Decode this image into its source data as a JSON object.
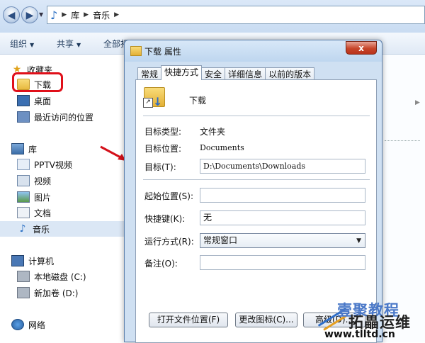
{
  "explorer": {
    "address": [
      "库",
      "音乐"
    ],
    "toolbar": {
      "organize": "组织",
      "share": "共享",
      "play_all": "全部播"
    },
    "sidebar": {
      "favorites": "收藏夹",
      "downloads": "下载",
      "desktop": "桌面",
      "recent": "最近访问的位置",
      "libraries": "库",
      "pptv": "PPTV视频",
      "videos": "视频",
      "pictures": "图片",
      "documents": "文档",
      "music": "音乐",
      "computer": "计算机",
      "local_disk": "本地磁盘 (C:)",
      "new_volume": "新加卷 (D:)",
      "network": "网络"
    }
  },
  "dialog": {
    "title": "下载 属性",
    "close": "x",
    "tabs": [
      "常规",
      "快捷方式",
      "安全",
      "详细信息",
      "以前的版本"
    ],
    "active_tab": "快捷方式",
    "name": "下载",
    "target_type_label": "目标类型:",
    "target_type_value": "文件夹",
    "target_location_label": "目标位置:",
    "target_location_value": "Documents",
    "target_label": "目标(T):",
    "target_value": "D:\\Documents\\Downloads",
    "start_in_label": "起始位置(S):",
    "start_in_value": "",
    "shortcut_key_label": "快捷键(K):",
    "shortcut_key_value": "无",
    "run_label": "运行方式(R):",
    "run_value": "常规窗口",
    "comment_label": "备注(O):",
    "comment_value": "",
    "buttons": {
      "open_location": "打开文件位置(F)",
      "change_icon": "更改图标(C)...",
      "advanced": "高级(D)..."
    }
  },
  "watermark": {
    "line1": "壹聚教程",
    "line2": "拓畾运维",
    "url": "www.tlltd.cn"
  },
  "colors": {
    "highlight_box": "#e0101a",
    "annotation_arrow": "#d4101a",
    "close_button": "#c7462b"
  }
}
